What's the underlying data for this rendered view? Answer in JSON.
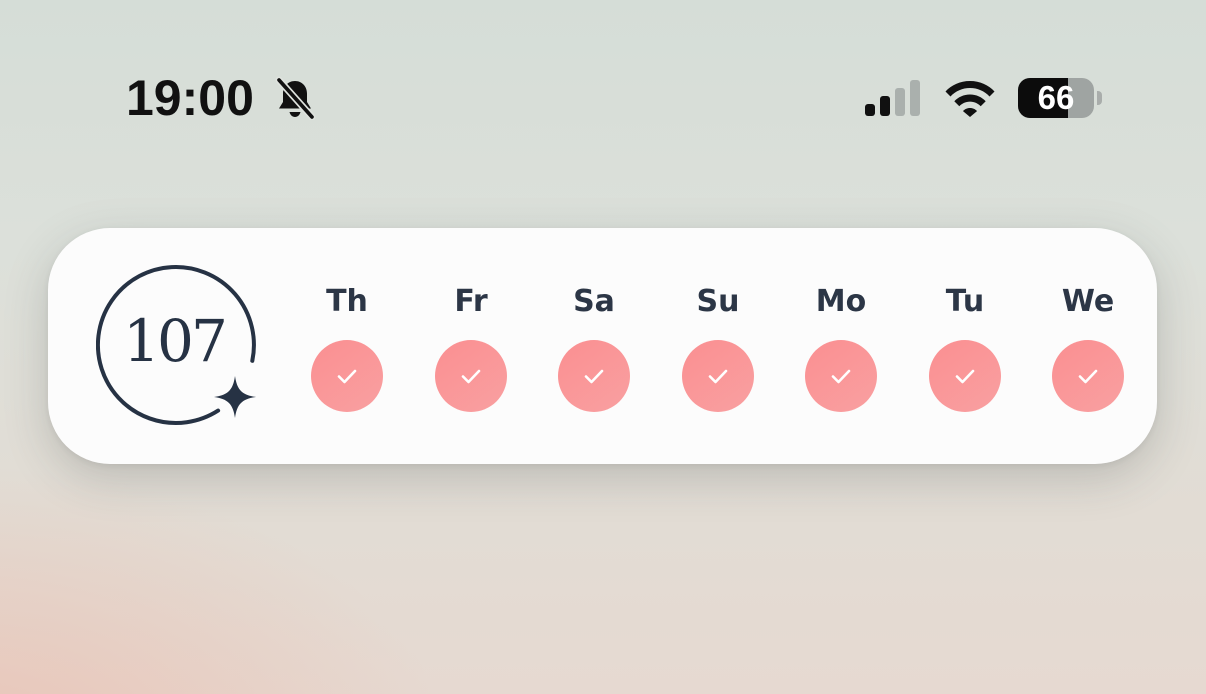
{
  "status_bar": {
    "time": "19:00",
    "silent_icon": "bell-slash-icon",
    "signal_icon": "cellular-signal-icon",
    "signal_bars_active": 2,
    "signal_bars_total": 4,
    "wifi_icon": "wifi-icon",
    "battery_icon": "battery-icon",
    "battery_percent": "66",
    "battery_level": 0.66
  },
  "widget": {
    "streak_count": "107",
    "streak_icon": "sparkle-icon",
    "days": [
      {
        "label": "Th",
        "completed": true,
        "icon": "checkmark-icon"
      },
      {
        "label": "Fr",
        "completed": true,
        "icon": "checkmark-icon"
      },
      {
        "label": "Sa",
        "completed": true,
        "icon": "checkmark-icon"
      },
      {
        "label": "Su",
        "completed": true,
        "icon": "checkmark-icon"
      },
      {
        "label": "Mo",
        "completed": true,
        "icon": "checkmark-icon"
      },
      {
        "label": "Tu",
        "completed": true,
        "icon": "checkmark-icon"
      },
      {
        "label": "We",
        "completed": true,
        "icon": "checkmark-icon"
      }
    ]
  },
  "colors": {
    "text_dark": "#263244",
    "check_circle": "#fa8f91",
    "widget_background": "#fcfcfc"
  }
}
